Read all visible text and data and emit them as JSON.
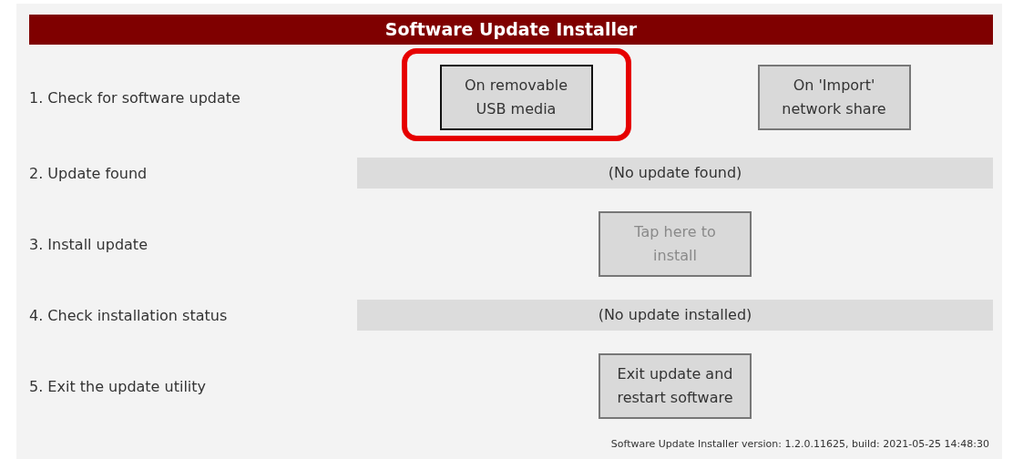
{
  "title": "Software Update Installer",
  "steps": [
    {
      "label": "1. Check for software update",
      "kind": "buttons",
      "buttons": [
        {
          "label": "On removable\nUSB media",
          "focused": true,
          "highlighted": true,
          "disabled": false
        },
        {
          "label": "On 'Import'\nnetwork share",
          "focused": false,
          "highlighted": false,
          "disabled": false
        }
      ]
    },
    {
      "label": "2. Update found",
      "kind": "status",
      "text": "(No update found)"
    },
    {
      "label": "3. Install update",
      "kind": "buttons",
      "buttons": [
        {
          "label": "Tap here to\ninstall",
          "focused": false,
          "highlighted": false,
          "disabled": true
        }
      ]
    },
    {
      "label": "4. Check installation status",
      "kind": "status",
      "text": "(No update installed)"
    },
    {
      "label": "5. Exit the update utility",
      "kind": "buttons",
      "buttons": [
        {
          "label": "Exit update and\nrestart software",
          "focused": false,
          "highlighted": false,
          "disabled": false
        }
      ]
    }
  ],
  "footer": "Software Update Installer version: 1.2.0.11625, build: 2021-05-25 14:48:30"
}
